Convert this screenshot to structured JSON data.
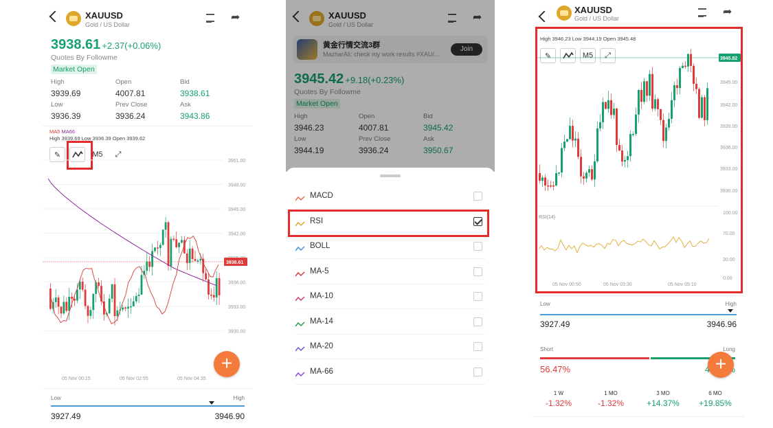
{
  "panel1": {
    "symbol": "XAUUSD",
    "subtitle": "Gold / US Dollar",
    "price": "3938.61",
    "change": "+2.37(+0.06%)",
    "quotes_by": "Quotes By Followme",
    "market_status": "Market Open",
    "quotes": {
      "high_label": "High",
      "high": "3939.69",
      "open_label": "Open",
      "open": "4007.81",
      "bid_label": "Bid",
      "bid": "3938.61",
      "low_label": "Low",
      "low": "3936.39",
      "prev_close_label": "Prev Close",
      "prev_close": "3936.24",
      "ask_label": "Ask",
      "ask": "3943.86"
    },
    "ma_legend": {
      "ma5": "MA5",
      "ma66": "MA66"
    },
    "chart_header": {
      "high": "High 3939.69",
      "low": "Low 3936.39",
      "open": "Open 3939.62"
    },
    "timeframe": "M5",
    "price_tag": "3938.61",
    "y_ticks": [
      "3951.00",
      "3948.00",
      "3945.00",
      "3942.00",
      "3939.00",
      "3936.00",
      "3933.00",
      "3930.00"
    ],
    "x_ticks": [
      "05 Nov 00:15",
      "05 Nov 02:55",
      "05 Nov 04:35"
    ],
    "range": {
      "low_label": "Low",
      "high_label": "High",
      "low": "3927.49",
      "high": "3946.90",
      "marker_fraction": 0.83
    }
  },
  "panel2": {
    "symbol": "XAUUSD",
    "subtitle": "Gold / US Dollar",
    "group": {
      "name": "黄金行情交流3群",
      "message": "MazharAli: check my work results #XAU/...",
      "join_label": "Join"
    },
    "price": "3945.42",
    "change": "+9.18(+0.23%)",
    "quotes_by": "Quotes By Followme",
    "market_status": "Market Open",
    "quotes": {
      "high_label": "High",
      "high": "3946.23",
      "open_label": "Open",
      "open": "4007.81",
      "bid_label": "Bid",
      "bid": "3945.42",
      "low_label": "Low",
      "low": "3944.19",
      "prev_close_label": "Prev Close",
      "prev_close": "3936.24",
      "ask_label": "Ask",
      "ask": "3950.67"
    },
    "indicators": [
      {
        "name": "MACD",
        "checked": false,
        "color": "#e0704a"
      },
      {
        "name": "RSI",
        "checked": true,
        "color": "#e0a82a"
      },
      {
        "name": "BOLL",
        "checked": false,
        "color": "#4a8fd6"
      },
      {
        "name": "MA-5",
        "checked": false,
        "color": "#d63a3a"
      },
      {
        "name": "MA-10",
        "checked": false,
        "color": "#d63a6a"
      },
      {
        "name": "MA-14",
        "checked": false,
        "color": "#2a9a4a"
      },
      {
        "name": "MA-20",
        "checked": false,
        "color": "#6a5ad6"
      },
      {
        "name": "MA-66",
        "checked": false,
        "color": "#8a4ad6"
      }
    ]
  },
  "panel3": {
    "symbol": "XAUUSD",
    "subtitle": "Gold / US Dollar",
    "chart_header": {
      "high": "High 3946.23",
      "low": "Low 3944.19",
      "open": "Open 3945.48"
    },
    "timeframe": "M5",
    "price_tag": "3945.82",
    "y_ticks": [
      "3945.00",
      "3942.00",
      "3939.00",
      "3936.00",
      "3933.00",
      "3930.00"
    ],
    "rsi_label": "RSI(14)",
    "rsi_ticks": [
      "100.00",
      "70.00",
      "30.00",
      "0.00"
    ],
    "x_ticks": [
      "05 Nov 00:50",
      "05 Nov 03:30",
      "05 Nov 05:10"
    ],
    "range": {
      "low_label": "Low",
      "high_label": "High",
      "low": "3927.49",
      "high": "3946.96",
      "marker_fraction": 0.97
    },
    "sentiment": {
      "short_label": "Short",
      "long_label": "Long",
      "short_pct": "56.47%",
      "long_pct": "43.53%",
      "short_fraction": 0.5647
    },
    "performance": [
      {
        "label": "1 W",
        "value": "-1.32%",
        "color": "#e03a3a"
      },
      {
        "label": "1 MO",
        "value": "-1.32%",
        "color": "#e03a3a"
      },
      {
        "label": "3 MO",
        "value": "+14.37%",
        "color": "#16a06e"
      },
      {
        "label": "6 MO",
        "value": "+19.85%",
        "color": "#16a06e"
      }
    ]
  },
  "colors": {
    "up": "#16a06e",
    "down": "#e03a3a",
    "accent": "#f47b3c",
    "highlight": "#e32b2b"
  }
}
